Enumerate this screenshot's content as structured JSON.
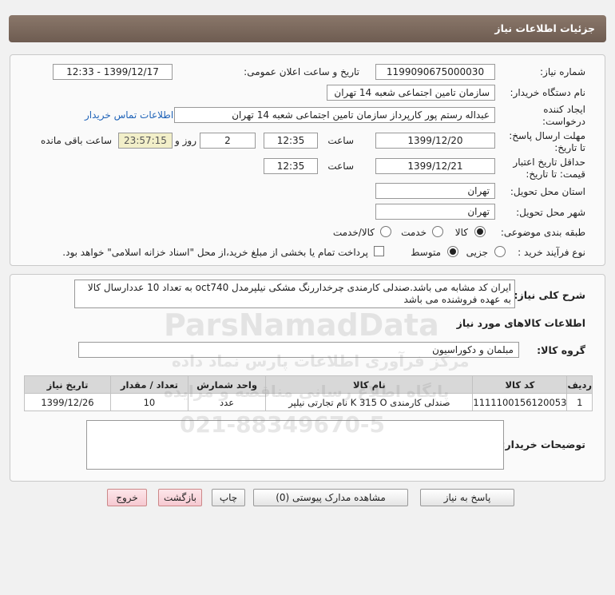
{
  "header": {
    "title": "جزئیات اطلاعات نیاز"
  },
  "info": {
    "need_number_label": "شماره نیاز:",
    "need_number": "1199090675000030",
    "announce_label": "تاریخ و ساعت اعلان عمومی:",
    "announce_value": "1399/12/17 - 12:33",
    "buyer_label": "نام دستگاه خریدار:",
    "buyer_value": "سازمان تامین اجتماعی شعبه 14 تهران",
    "creator_label_1": "ایجاد کننده",
    "creator_label_2": "درخواست:",
    "creator_value": "عبداله رستم پور کارپرداز سازمان تامین اجتماعی شعبه 14 تهران",
    "contact_link": "اطلاعات تماس خریدار",
    "deadline_label_1": "مهلت ارسال پاسخ:",
    "deadline_label_2": "تا تاریخ:",
    "deadline_date": "1399/12/20",
    "time_label": "ساعت",
    "deadline_time": "12:35",
    "days_value": "2",
    "days_label": "روز و",
    "remaining_time": "23:57:15",
    "remaining_label": "ساعت باقی مانده",
    "validity_label_1": "حداقل تاریخ اعتبار",
    "validity_label_2": "قیمت: تا تاریخ:",
    "validity_date": "1399/12/21",
    "validity_time": "12:35",
    "province_label": "استان محل تحویل:",
    "province_value": "تهران",
    "city_label": "شهر محل تحویل:",
    "city_value": "تهران",
    "category_label": "طبقه بندی موضوعی:",
    "category_options": [
      "کالا",
      "خدمت",
      "کالا/خدمت"
    ],
    "category_selected": "کالا",
    "process_label": "نوع فرآیند خرید :",
    "process_options": [
      "جزیی",
      "متوسط"
    ],
    "process_selected": "متوسط",
    "payment_note": "پرداخت تمام یا بخشی از مبلغ خرید،از محل \"اسناد خزانه اسلامی\" خواهد بود."
  },
  "description": {
    "label": "شرح کلی نیاز:",
    "line1": "ایران کد مشابه می باشد.صندلی کارمندی چرخداررنگ مشکی نیلپرمدل oct740 به تعداد 10 عددارسال کالا",
    "line2": "به عهده فروشنده می باشد"
  },
  "goods": {
    "section_title": "اطلاعات کالاهای مورد نیاز",
    "group_label": "گروه کالا:",
    "group_value": "مبلمان و دکوراسیون",
    "columns": [
      "ردیف",
      "کد کالا",
      "نام کالا",
      "واحد شمارش",
      "تعداد / مقدار",
      "تاریخ نیاز"
    ],
    "rows": [
      [
        "1",
        "1111100156120053",
        "صندلی کارمندی K 315 O نام تجارتی نیلپر",
        "عدد",
        "10",
        "1399/12/26"
      ]
    ]
  },
  "buyer_notes_label": "توضیحات خریدار:",
  "buttons": {
    "reply": "پاسخ به نیاز",
    "attachments": "مشاهده مدارک پیوستی (0)",
    "print": "چاپ",
    "back": "بازگشت",
    "exit": "خروج"
  },
  "watermark": {
    "brand": "ParsNamadData",
    "line1": "مرکز فرآوری اطلاعات پارس نماد داده",
    "line2": "پایگاه اطلاع رسانی مناقصه و مزایده",
    "phone": "021-88349670-5"
  }
}
